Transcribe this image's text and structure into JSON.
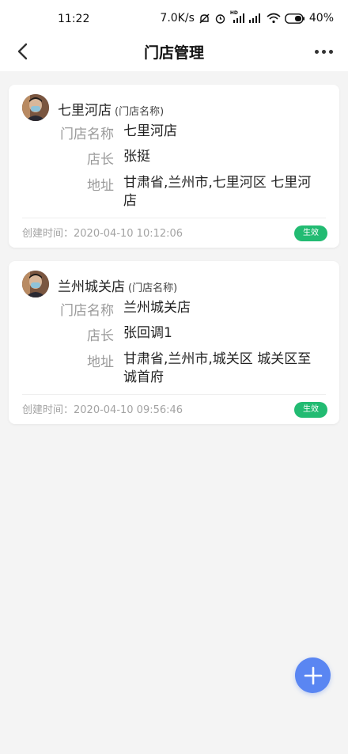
{
  "status_bar": {
    "time": "11:22",
    "network_speed": "7.0K/s",
    "hd_label": "HD",
    "battery": "40%"
  },
  "header": {
    "title": "门店管理"
  },
  "stores": [
    {
      "name": "七里河店",
      "name_hint": "(门店名称)",
      "fields": {
        "store_name_label": "门店名称",
        "store_name": "七里河店",
        "manager_label": "店长",
        "manager": "张挺",
        "address_label": "地址",
        "address": "甘肃省,兰州市,七里河区 七里河店"
      },
      "created": "创建时间：2020-04-10 10:12:06",
      "status": "生效"
    },
    {
      "name": "兰州城关店",
      "name_hint": "(门店名称)",
      "fields": {
        "store_name_label": "门店名称",
        "store_name": "兰州城关店",
        "manager_label": "店长",
        "manager": "张回调1",
        "address_label": "地址",
        "address": "甘肃省,兰州市,城关区 城关区至诚首府"
      },
      "created": "创建时间：2020-04-10 09:56:46",
      "status": "生效"
    }
  ],
  "colors": {
    "badge_green": "#22bb72",
    "fab_blue": "#5a86f2",
    "background": "#f4f4f4"
  },
  "icons": {
    "back": "chevron-left-icon",
    "more": "more-horizontal-icon",
    "add": "plus-icon"
  }
}
